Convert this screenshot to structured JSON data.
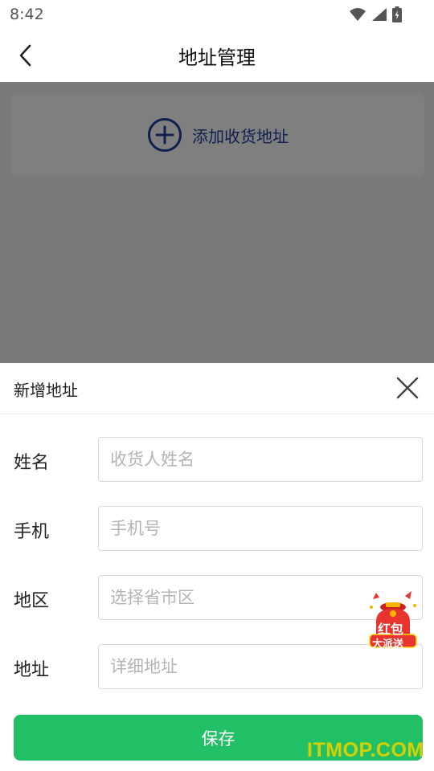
{
  "status_bar": {
    "time": "8:42",
    "icons": [
      "wifi-icon",
      "signal-icon",
      "battery-charging-icon"
    ]
  },
  "app_bar": {
    "title": "地址管理",
    "back_icon": "chevron-left-icon"
  },
  "address_list": {
    "add_label": "添加收货地址",
    "add_icon": "plus-circle-icon",
    "accent_color": "#1e3fa0"
  },
  "sheet": {
    "title": "新增地址",
    "close_icon": "close-icon",
    "fields": [
      {
        "label": "姓名",
        "placeholder": "收货人姓名"
      },
      {
        "label": "手机",
        "placeholder": "手机号"
      },
      {
        "label": "地区",
        "placeholder": "选择省市区"
      },
      {
        "label": "地址",
        "placeholder": "详细地址"
      }
    ],
    "save_label": "保存",
    "save_color": "#22c066"
  },
  "promo": {
    "text_line1": "红包",
    "text_line2": "大派送"
  },
  "watermark": "ITMOP.COM"
}
